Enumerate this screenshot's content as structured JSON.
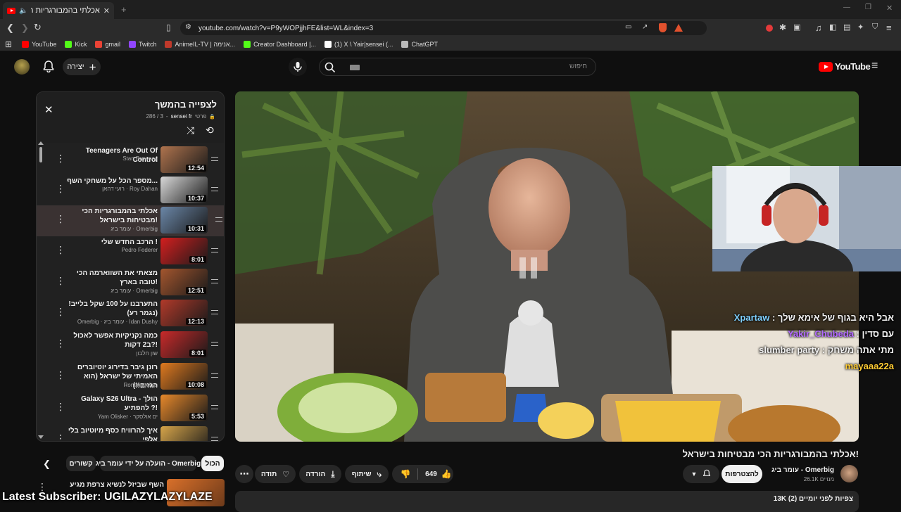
{
  "browser": {
    "tab_title": "אכלתי בהמבורגריות הכי מבט",
    "url": "youtube.com/watch?v=P9yWOPjjhFE&list=WL&index=3",
    "bookmarks": [
      {
        "label": "YouTube",
        "color": "#ff0000"
      },
      {
        "label": "Kick",
        "color": "#53fc18"
      },
      {
        "label": "gmail",
        "color": "#ea4335"
      },
      {
        "label": "Twitch",
        "color": "#9146ff"
      },
      {
        "label": "AnimeIL-TV | אנימה...",
        "color": "#c0392b"
      },
      {
        "label": "Creator Dashboard |...",
        "color": "#53fc18"
      },
      {
        "label": "(1) X \\ Yair|sensei (...",
        "color": "#ffffff"
      },
      {
        "label": "ChatGPT",
        "color": "#bbbbbb"
      }
    ]
  },
  "masthead": {
    "create_label": "יצירה",
    "search_placeholder": "חיפוש",
    "logo_text": "YouTube"
  },
  "playlist": {
    "title": "לצפייה בהמשך",
    "owner": "sensei fr",
    "privacy": "פרטי",
    "position": "286 / 3",
    "items": [
      {
        "title": "Teenagers Are Out Of Control",
        "channel": "Stan Browney",
        "duration": "12:54",
        "thumb": "#b0744e",
        "active": false
      },
      {
        "title": "מספר הכל על משחקי השף...",
        "channel": "רועי דהאן · Roy Dahan",
        "duration": "10:37",
        "thumb": "#d9d9d9",
        "active": false
      },
      {
        "title": "אכלתי בהמבורגריות הכי מבטיחות בישראל!",
        "channel": "עומר ביג · Omerbig",
        "duration": "10:31",
        "thumb": "#6b87a8",
        "active": true
      },
      {
        "title": "הרכב החדש שלי !",
        "channel": "Pedro Federer",
        "duration": "8:01",
        "thumb": "#d41f1f",
        "active": false
      },
      {
        "title": "מצאתי את השווארמה הכי טובה בארץ!",
        "channel": "עומר ביג · Omerbig",
        "duration": "12:51",
        "thumb": "#a4562e",
        "active": false
      },
      {
        "title": "התערבנו על 100 שקל בלייב! (נגמר רע)",
        "channel": "Omerbig · עומר ביג · Idan Dushy",
        "duration": "12:13",
        "thumb": "#b23a2a",
        "active": false
      },
      {
        "title": "כמה נקניקיות אפשר לאכול ב2 דקות?!",
        "channel": "שון חלבון",
        "duration": "8:01",
        "thumb": "#c92a2a",
        "active": false
      },
      {
        "title": "רונן גיבר בדירוג יוטיוברים האמיתי של ישראל (הוא הגזים!!)",
        "channel": "Ronenggclips",
        "duration": "10:08",
        "thumb": "#e07a1f",
        "active": false
      },
      {
        "title": "Galaxy S26 Ultra - הולך להפתיע ?!",
        "channel": "Yam Olisker · ים אולסקר",
        "duration": "5:53",
        "thumb": "#e8892b",
        "active": false
      },
      {
        "title": "איך להרוויח כסף מיוטיוב בלי אלפי",
        "channel": "",
        "duration": "",
        "thumb": "#d7a54a",
        "active": false
      }
    ]
  },
  "chips": {
    "all": "הכול",
    "uploaded_by": "הועלה על ידי עומר ביג - Omerbig",
    "related": "קשורים"
  },
  "next_video": {
    "title": "השף שביזל לנשיא צרפת מגיע"
  },
  "video": {
    "title": "אכלתי בהמבורגריות הכי מבטיחות בישראל!",
    "channel": "עומר ביג - Omerbig",
    "subscribers": "26.1K מנויים",
    "subscribe_label": "להצטרפות",
    "likes": "649",
    "share_label": "שיתוף",
    "download_label": "הורדה",
    "thanks_label": "תודה",
    "views_line": "13K צפיות  לפני יומיים (2)"
  },
  "overlay": {
    "chat": [
      {
        "user": "Xpartaw",
        "msg": "אבל היא בגוף של אימא שלך",
        "color": "#7fd0ff"
      },
      {
        "user": "Yakir_Chubeda",
        "msg": "עם סדין",
        "color": "#b36bff"
      },
      {
        "user": "mayaaa22a",
        "msg": "מתי אתה משחק slumber party",
        "color": "#ffcc33"
      }
    ],
    "ticker_label": "Latest Subscriber:",
    "ticker_name": "UGILAZYLAZYLAZE"
  }
}
